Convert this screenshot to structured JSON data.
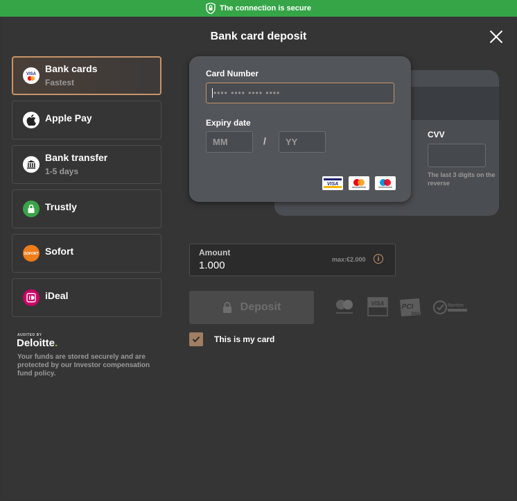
{
  "banner": {
    "text": "The connection is secure"
  },
  "modal": {
    "title": "Bank card deposit"
  },
  "methods": [
    {
      "label": "Bank cards",
      "sub": "Fastest",
      "icon": "visa-mastercard-icon"
    },
    {
      "label": "Apple Pay",
      "sub": "",
      "icon": "apple-icon"
    },
    {
      "label": "Bank transfer",
      "sub": "1-5 days",
      "icon": "bank-icon"
    },
    {
      "label": "Trustly",
      "sub": "",
      "icon": "trustly-icon"
    },
    {
      "label": "Sofort",
      "sub": "",
      "icon": "sofort-icon"
    },
    {
      "label": "iDeal",
      "sub": "",
      "icon": "ideal-icon"
    }
  ],
  "audit": {
    "small": "AUDITED BY",
    "brand": "Deloitte",
    "dot": ".",
    "text": "Your funds are stored securely and are protected by our Investor compensation fund policy."
  },
  "card": {
    "number_label": "Card Number",
    "number_placeholder": "•••• •••• •••• ••••",
    "expiry_label": "Expiry date",
    "mm_placeholder": "MM",
    "separator": "/",
    "yy_placeholder": "YY",
    "cvv_label": "CVV",
    "cvv_hint": "The last 3 digits on the reverse",
    "logos": [
      "visa-logo",
      "mastercard-logo",
      "maestro-logo"
    ]
  },
  "amount": {
    "label": "Amount",
    "value": "1.000",
    "max": "max:€2.000"
  },
  "deposit_button": "Deposit",
  "security_badges": [
    "mastercard-securecode-icon",
    "verified-by-visa-icon",
    "pci-dss-icon",
    "norton-secured-icon"
  ],
  "checkbox": {
    "label": "This is my card",
    "checked": true
  },
  "colors": {
    "accent": "#c8946a",
    "banner": "#35a547",
    "background": "#353535"
  }
}
